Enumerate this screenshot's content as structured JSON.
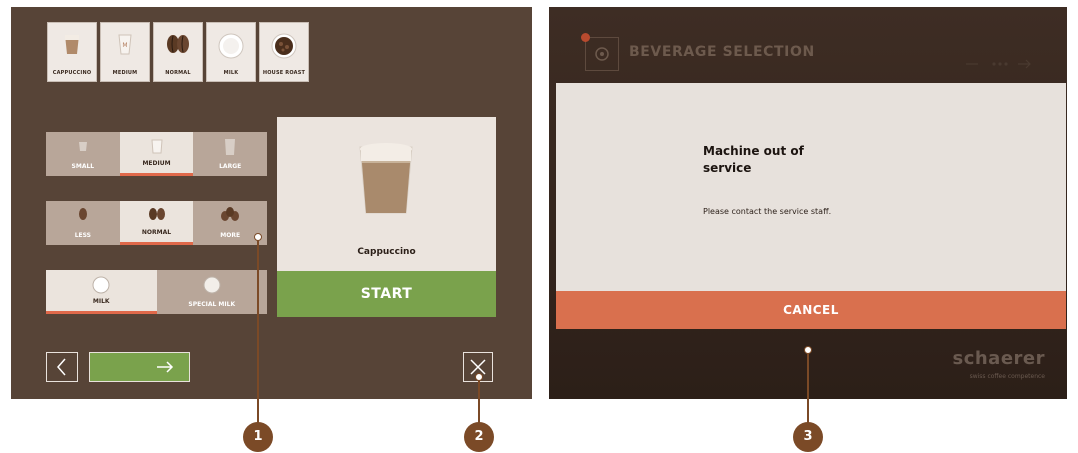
{
  "left_screen": {
    "summary_chips": [
      {
        "label": "CAPPUCCINO",
        "icon": "cappuccino-cup-icon"
      },
      {
        "label": "MEDIUM",
        "icon": "medium-cup-icon"
      },
      {
        "label": "NORMAL",
        "icon": "coffee-beans-icon"
      },
      {
        "label": "MILK",
        "icon": "milk-icon"
      },
      {
        "label": "HOUSE ROAST",
        "icon": "roast-beans-icon"
      }
    ],
    "size_options": [
      {
        "label": "SMALL",
        "selected": false
      },
      {
        "label": "MEDIUM",
        "selected": true
      },
      {
        "label": "LARGE",
        "selected": false
      }
    ],
    "strength_options": [
      {
        "label": "LESS",
        "selected": false
      },
      {
        "label": "NORMAL",
        "selected": true
      },
      {
        "label": "MORE",
        "selected": false
      }
    ],
    "milk_options": [
      {
        "label": "MILK",
        "selected": true
      },
      {
        "label": "SPECIAL MILK",
        "selected": false
      }
    ],
    "product": {
      "name": "Cappuccino"
    },
    "start_label": "START",
    "next_arrow": "→",
    "back_arrow": "‹",
    "close_symbol": "✕"
  },
  "right_screen": {
    "header_title": "BEVERAGE SELECTION",
    "dialog": {
      "title": "Machine out of service",
      "message": "Please contact the service staff."
    },
    "cancel_label": "CANCEL",
    "brand": {
      "logo": "schaerer",
      "tagline": "swiss coffee competence"
    }
  },
  "callouts": [
    "1",
    "2",
    "3"
  ],
  "colors": {
    "accent_orange": "#e0694a",
    "start_green": "#7aa24c",
    "screen_brown": "#574437",
    "callout_brown": "#7b4a27"
  }
}
